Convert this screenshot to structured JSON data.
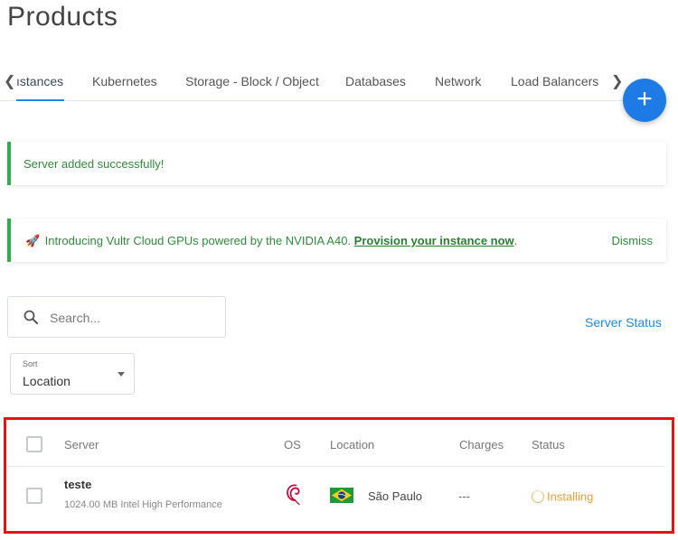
{
  "page": {
    "title": "Products"
  },
  "tabs": {
    "items": [
      {
        "label": "ıstances",
        "active": true
      },
      {
        "label": "Kubernetes"
      },
      {
        "label": "Storage - Block / Object"
      },
      {
        "label": "Databases"
      },
      {
        "label": "Network"
      },
      {
        "label": "Load Balancers"
      }
    ],
    "prev_icon": "chevron-left-icon",
    "next_icon": "chevron-right-icon"
  },
  "fab": {
    "icon": "plus-icon",
    "glyph": "+"
  },
  "alerts": {
    "success": {
      "message": "Server added successfully!"
    },
    "promo": {
      "icon": "rocket-icon",
      "icon_glyph": "🚀",
      "message": "Introducing Vultr Cloud GPUs powered by the NVIDIA A40.",
      "link_text": "Provision your instance now",
      "suffix": ".",
      "dismiss_label": "Dismiss"
    }
  },
  "search": {
    "placeholder": "Search..."
  },
  "server_status_link": "Server Status",
  "sort": {
    "label": "Sort",
    "value": "Location"
  },
  "table": {
    "headers": {
      "server": "Server",
      "os": "OS",
      "location": "Location",
      "charges": "Charges",
      "status": "Status"
    },
    "rows": [
      {
        "name": "teste",
        "plan": "1024.00 MB Intel High Performance",
        "os_icon": "debian-icon",
        "flag_icon": "brazil-flag-icon",
        "location": "São Paulo",
        "charges": "---",
        "status": "Installing"
      }
    ]
  },
  "colors": {
    "accent": "#1e88e5",
    "success": "#34a853",
    "installing": "#f39c32",
    "highlight_frame": "#e31414",
    "debian": "#c70036"
  }
}
